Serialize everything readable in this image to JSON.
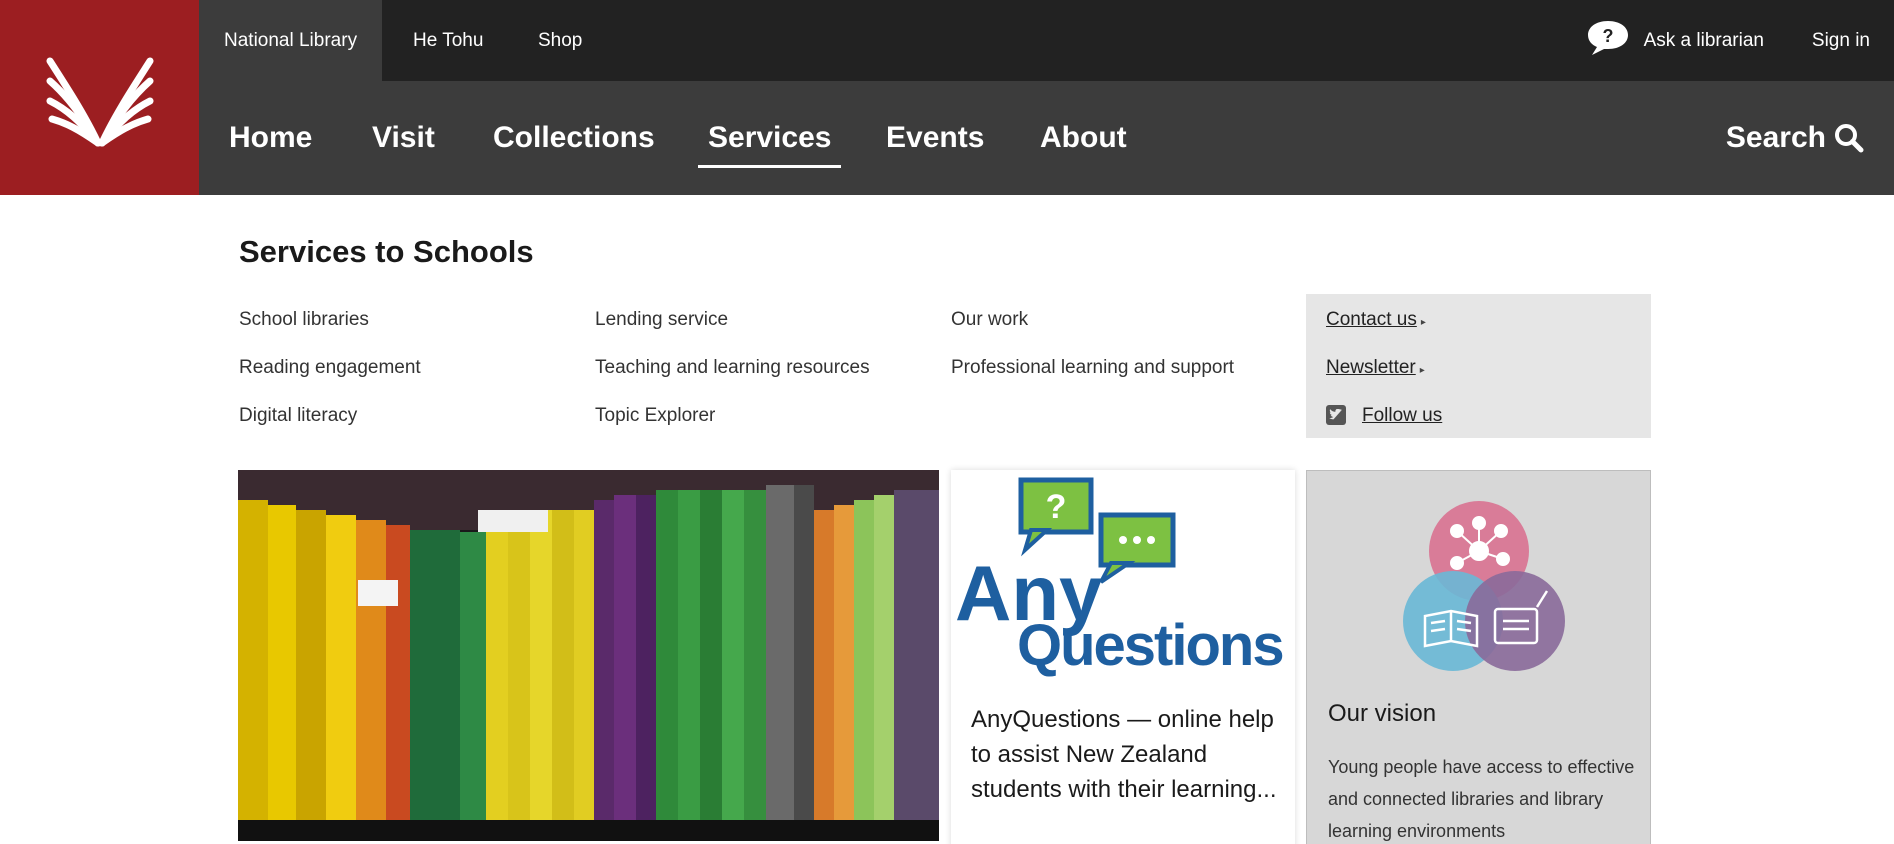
{
  "topbar": {
    "tabs": [
      {
        "label": "National Library",
        "active": true
      },
      {
        "label": "He Tohu",
        "active": false
      },
      {
        "label": "Shop",
        "active": false
      }
    ],
    "ask_label": "Ask a librarian",
    "signin_label": "Sign in"
  },
  "mainnav": {
    "items": [
      {
        "label": "Home"
      },
      {
        "label": "Visit"
      },
      {
        "label": "Collections"
      },
      {
        "label": "Services",
        "active": true
      },
      {
        "label": "Events"
      },
      {
        "label": "About"
      }
    ],
    "search_label": "Search"
  },
  "section": {
    "title": "Services to Schools",
    "links": {
      "col1": [
        "School libraries",
        "Reading engagement",
        "Digital literacy"
      ],
      "col2": [
        "Lending service",
        "Teaching and learning resources",
        "Topic Explorer"
      ],
      "col3": [
        "Our work",
        "Professional learning and support"
      ]
    }
  },
  "sidebox": {
    "contact": "Contact us",
    "newsletter": "Newsletter",
    "follow": "Follow us"
  },
  "cards": {
    "anyquestions": {
      "logo_word1": "Any",
      "logo_word2": "Questions",
      "title": "AnyQuestions — online help to assist New Zealand students with their learning..."
    },
    "vision": {
      "title": "Our vision",
      "text": "Young people have access to effective and connected libraries and library learning environments"
    }
  },
  "colors": {
    "brand_red": "#9c1e21",
    "topbar_bg": "#222222",
    "nav_bg": "#3c3c3c"
  },
  "icons": {
    "logo": "book-pages-icon",
    "ask": "speech-bubble-question-icon",
    "search": "magnifier-icon",
    "follow": "twitter-icon"
  }
}
